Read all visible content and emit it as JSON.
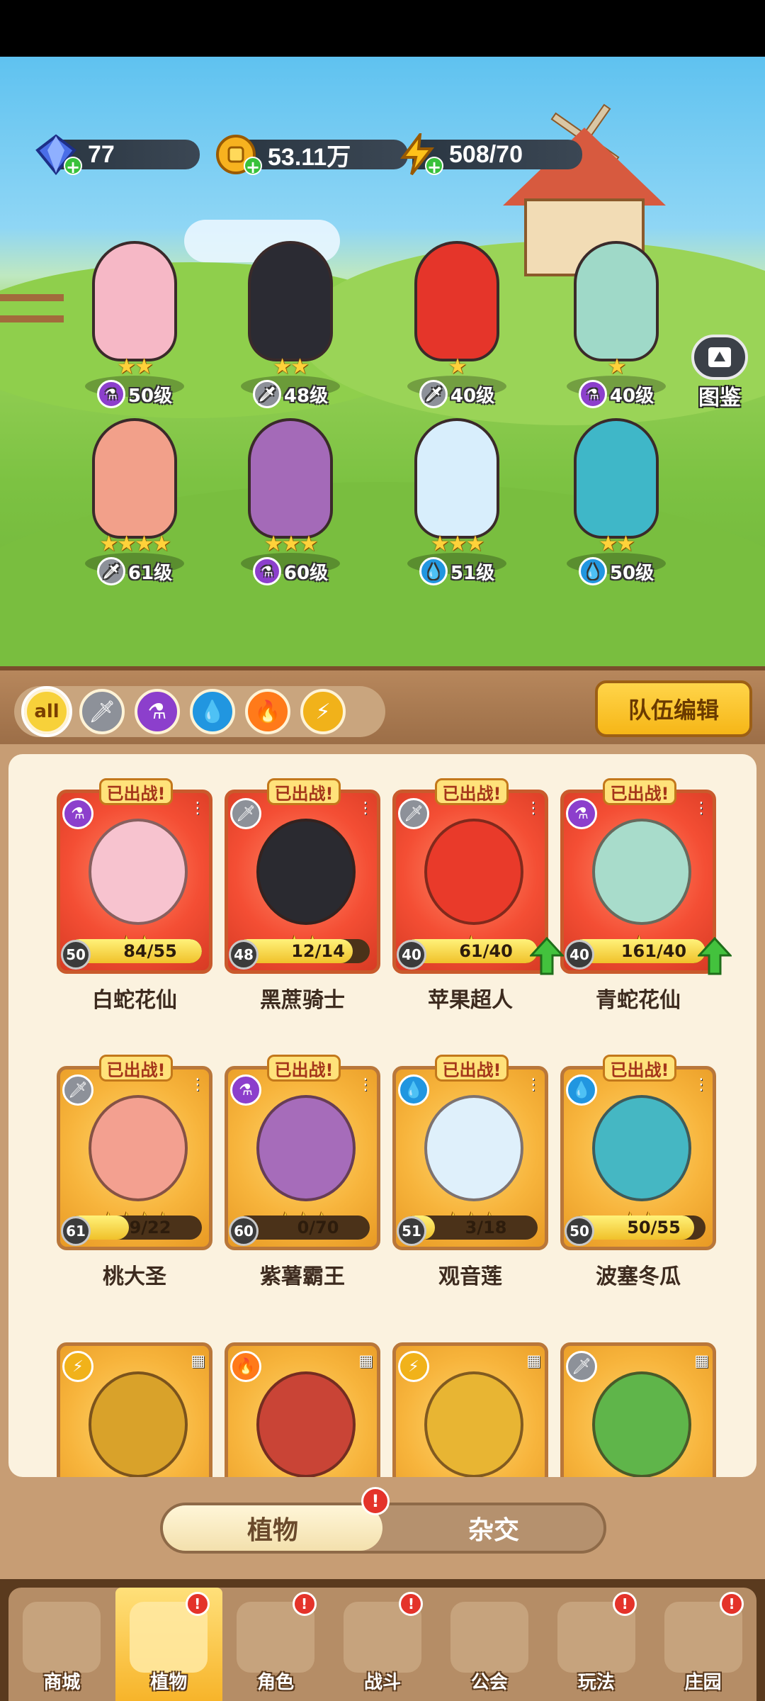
{
  "resources": {
    "gems": "77",
    "coins": "53.11万",
    "energy": "508/70"
  },
  "codex_label": "图鉴",
  "team": [
    {
      "level_text": "50级",
      "stars": "★★",
      "element": "magic",
      "color": "#f6b8c6"
    },
    {
      "level_text": "48级",
      "stars": "★★",
      "element": "sword",
      "color": "#2b2b33"
    },
    {
      "level_text": "40级",
      "stars": "★",
      "element": "sword",
      "color": "#e5352a"
    },
    {
      "level_text": "40级",
      "stars": "★",
      "element": "magic",
      "color": "#9fd9c8"
    },
    {
      "level_text": "61级",
      "stars": "★★★★",
      "element": "sword",
      "color": "#f2a08a"
    },
    {
      "level_text": "60级",
      "stars": "★★★",
      "element": "magic",
      "color": "#a46ab8"
    },
    {
      "level_text": "51级",
      "stars": "★★★",
      "element": "water",
      "color": "#d8eefc"
    },
    {
      "level_text": "50级",
      "stars": "★★",
      "element": "water",
      "color": "#3fb7c8"
    }
  ],
  "filters": [
    "all",
    "sword",
    "magic",
    "water",
    "fire",
    "bolt"
  ],
  "team_edit_label": "队伍编辑",
  "deployed_label": "已出战!",
  "cards": [
    {
      "name": "白蛇花仙",
      "level": "50",
      "progress": "84/55",
      "fill": 1.0,
      "stars": "★★",
      "theme": "red",
      "element": "magic",
      "upgrade": false,
      "portrait": "#f7c3cf"
    },
    {
      "name": "黑蔗骑士",
      "level": "48",
      "progress": "12/14",
      "fill": 0.86,
      "stars": "★★",
      "theme": "red",
      "element": "sword",
      "upgrade": false,
      "portrait": "#2a2a30"
    },
    {
      "name": "苹果超人",
      "level": "40",
      "progress": "61/40",
      "fill": 1.0,
      "stars": "★",
      "theme": "red",
      "element": "sword",
      "upgrade": true,
      "portrait": "#e93a2a"
    },
    {
      "name": "青蛇花仙",
      "level": "40",
      "progress": "161/40",
      "fill": 1.0,
      "stars": "★",
      "theme": "red",
      "element": "magic",
      "upgrade": true,
      "portrait": "#a8dccb"
    },
    {
      "name": "桃大圣",
      "level": "61",
      "progress": "9/22",
      "fill": 0.41,
      "stars": "★★★★",
      "theme": "gold",
      "element": "sword",
      "upgrade": false,
      "portrait": "#f3a090"
    },
    {
      "name": "紫薯霸王",
      "level": "60",
      "progress": "0/70",
      "fill": 0.0,
      "stars": "★★★",
      "theme": "gold",
      "element": "magic",
      "upgrade": false,
      "portrait": "#a66cba"
    },
    {
      "name": "观音莲",
      "level": "51",
      "progress": "3/18",
      "fill": 0.17,
      "stars": "★★★",
      "theme": "gold",
      "element": "water",
      "upgrade": false,
      "portrait": "#dff0fb"
    },
    {
      "name": "波塞冬瓜",
      "level": "50",
      "progress": "50/55",
      "fill": 0.91,
      "stars": "★★",
      "theme": "gold",
      "element": "water",
      "upgrade": false,
      "portrait": "#45b7c3"
    }
  ],
  "partial_cards": [
    {
      "element": "bolt",
      "portrait": "#d9a22a"
    },
    {
      "element": "fire",
      "portrait": "#c94436"
    },
    {
      "element": "bolt",
      "portrait": "#e8b533"
    },
    {
      "element": "sword",
      "portrait": "#5fb54a"
    }
  ],
  "toggle": {
    "plants": "植物",
    "hybrid": "杂交",
    "alert": "!"
  },
  "nav": [
    {
      "label": "商城",
      "alert": false
    },
    {
      "label": "植物",
      "alert": true,
      "active": true
    },
    {
      "label": "角色",
      "alert": true
    },
    {
      "label": "战斗",
      "alert": true
    },
    {
      "label": "公会",
      "alert": false
    },
    {
      "label": "玩法",
      "alert": true
    },
    {
      "label": "庄园",
      "alert": true
    }
  ],
  "icons": {
    "magic": "⚗",
    "sword": "🗡",
    "water": "💧",
    "fire": "🔥",
    "bolt": "⚡",
    "all": "all"
  }
}
